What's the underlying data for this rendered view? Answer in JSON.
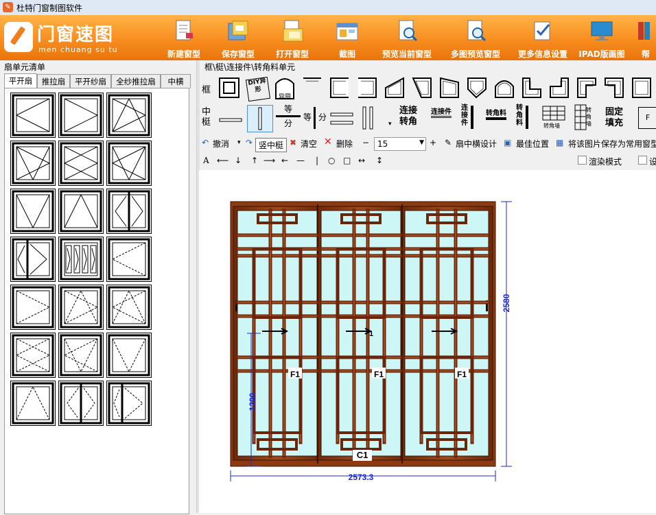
{
  "window": {
    "title": "杜特门窗制图软件"
  },
  "logo": {
    "cn": "门窗速图",
    "pinyin": "men chuang su tu"
  },
  "ribbon": [
    {
      "label": "新建窗型",
      "icon": "new-document-icon"
    },
    {
      "label": "保存窗型",
      "icon": "save-icon"
    },
    {
      "label": "打开窗型",
      "icon": "open-file-icon"
    },
    {
      "label": "截图",
      "icon": "screenshot-icon"
    },
    {
      "label": "预览当前窗型",
      "icon": "preview-icon"
    },
    {
      "label": "多图预览窗型",
      "icon": "multi-preview-icon"
    },
    {
      "label": "更多信息设置",
      "icon": "settings-icon"
    },
    {
      "label": "IPAD版画图",
      "icon": "ipad-icon"
    },
    {
      "label": "帮",
      "icon": "help-book-icon"
    }
  ],
  "left_panel": {
    "title": "扇单元清单",
    "tabs": [
      "平开扇",
      "推拉扇",
      "平开纱扇",
      "全纱推拉扇",
      "中横"
    ]
  },
  "right_panel": {
    "group_title": "框\\梃\\连接件\\转角料单元",
    "row_frame_label": "框",
    "row_mullion_label": "中梃",
    "diy_label": "DIY异形",
    "arc_label": "异圆",
    "equal_div_label": "等分",
    "equal_label": "等",
    "div_label": "分",
    "connect_corner_label": "连接转角",
    "connector_label": "连接件",
    "connector2_label": "连接件",
    "corner_material_label": "转角料",
    "corner_material2_label": "转角料",
    "corner_wall_label": "转角墙",
    "corner_wall2_label": "转角墙",
    "fixed_fill_label": "固定填充",
    "f_label": "F"
  },
  "toolbar": {
    "undo": "撤消",
    "tooltip": "竖中梃",
    "clear": "清空",
    "delete": "删除",
    "minus": "−",
    "size_value": "15",
    "plus": "+",
    "sash_transom": "扇中横设计",
    "best_position": "最佳位置",
    "save_common": "将该图片保存为常用窗型",
    "render_mode": "渲染模式",
    "setting_short": "设"
  },
  "drawing": {
    "width": "2573.3",
    "height": "2580",
    "left_height": "1290",
    "frame_label": "C1",
    "sash_labels": [
      "F1",
      "F1",
      "F1"
    ],
    "sash_number": "1",
    "colors": {
      "wood": "#8c3a12",
      "glass": "#cdf7f7",
      "dimension": "#1a2ad6"
    }
  }
}
